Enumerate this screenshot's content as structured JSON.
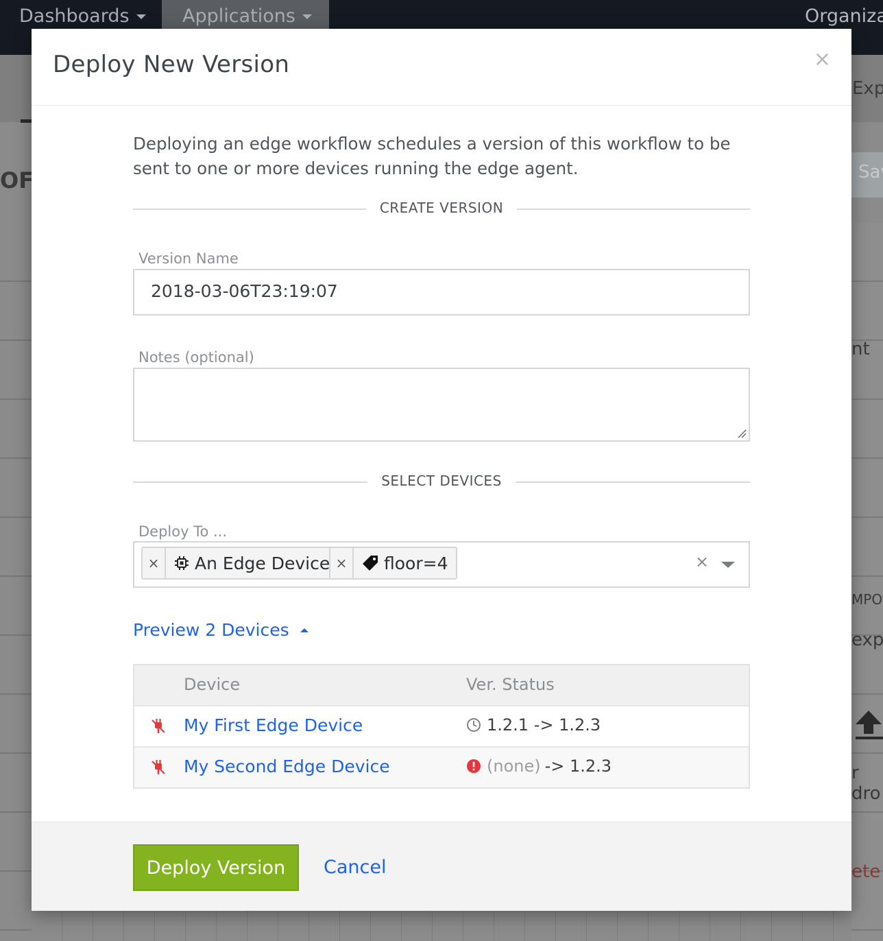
{
  "background": {
    "nav": {
      "dashboards_label": "Dashboards",
      "applications_label": "Applications",
      "organization_label": "Organizat"
    },
    "fragments": {
      "explore": "Expl",
      "title_partial": "OF G",
      "save": "Sav",
      "nt": "nt",
      "import": "MPOR",
      "export": "expo",
      "drop": "r dro",
      "delete": "ete"
    }
  },
  "modal": {
    "title": "Deploy New Version",
    "close_label": "×",
    "intro": "Deploying an edge workflow schedules a version of this workflow to be sent to one or more devices running the edge agent.",
    "create_section": "CREATE VERSION",
    "version_name_label": "Version Name",
    "version_name_value": "2018-03-06T23:19:07",
    "notes_label": "Notes (optional)",
    "notes_value": "",
    "select_section": "SELECT DEVICES",
    "deploy_to_label": "Deploy To ...",
    "chips": [
      {
        "remove": "×",
        "label": "An Edge Device",
        "icon": "chip-icon"
      },
      {
        "remove": "×",
        "label": "floor=4",
        "icon": "tag-icon"
      }
    ],
    "clear_label": "×",
    "preview_label": "Preview 2 Devices",
    "table": {
      "headers": {
        "device": "Device",
        "status": "Ver. Status"
      },
      "rows": [
        {
          "device": "My First Edge Device",
          "status_icon": "clock-icon",
          "status_from": "1.2.1",
          "status_to": "-> 1.2.3"
        },
        {
          "device": "My Second Edge Device",
          "status_icon": "alert-icon",
          "status_from": "(none)",
          "status_to": "-> 1.2.3"
        }
      ]
    },
    "deploy_button": "Deploy Version",
    "cancel_button": "Cancel"
  },
  "colors": {
    "accent_link": "#1f63e6",
    "deploy_green": "#84b320",
    "disconnected_red": "#e23a3a",
    "alert_red": "#e8343c"
  }
}
